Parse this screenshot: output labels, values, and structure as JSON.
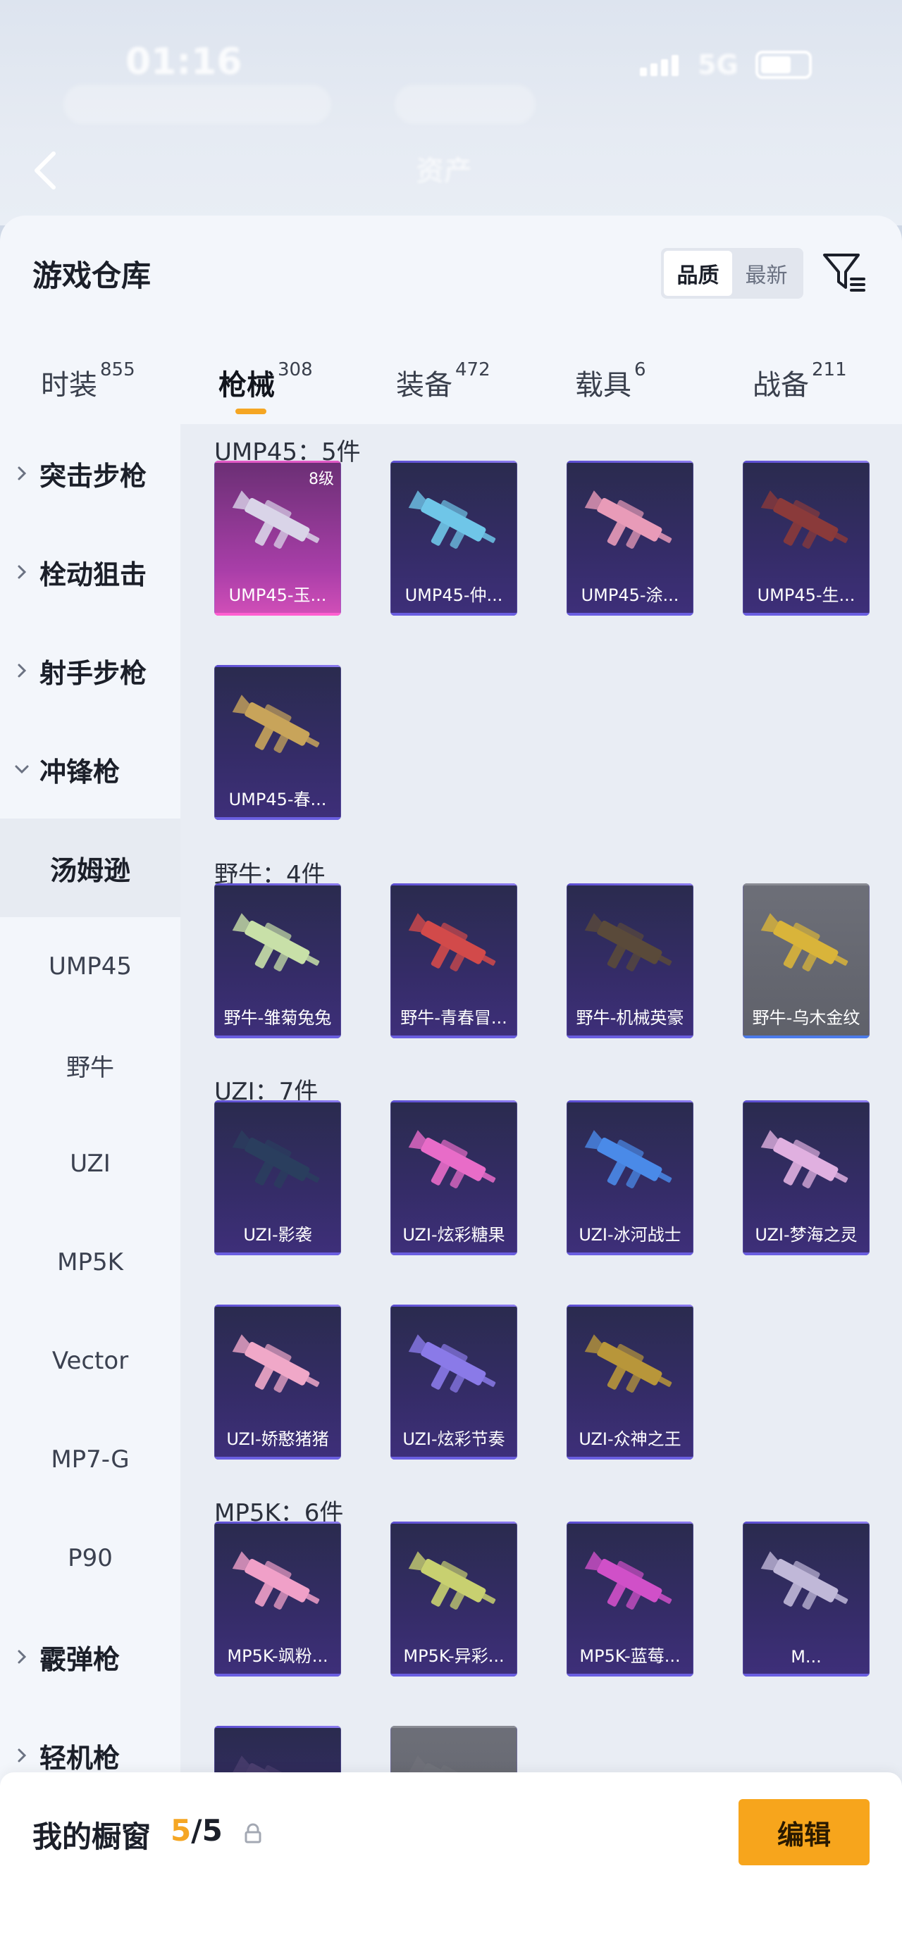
{
  "status_bar": {
    "time": "01:16",
    "network": "5G"
  },
  "header": {
    "title": "资产"
  },
  "warehouse": {
    "title": "游戏仓库",
    "sort_options": [
      "品质",
      "最新"
    ],
    "active_sort": "品质"
  },
  "tabs": [
    {
      "label": "时装",
      "count": "855"
    },
    {
      "label": "枪械",
      "count": "308"
    },
    {
      "label": "装备",
      "count": "472"
    },
    {
      "label": "载具",
      "count": "6"
    },
    {
      "label": "战备",
      "count": "211"
    }
  ],
  "active_tab": "枪械",
  "sidebar": {
    "groups": [
      {
        "label": "突击步枪",
        "expanded": false
      },
      {
        "label": "栓动狙击",
        "expanded": false
      },
      {
        "label": "射手步枪",
        "expanded": false
      },
      {
        "label": "冲锋枪",
        "expanded": true
      },
      {
        "label": "霰弹枪",
        "expanded": false
      },
      {
        "label": "轻机枪",
        "expanded": false
      }
    ],
    "subitems": [
      "汤姆逊",
      "UMP45",
      "野牛",
      "UZI",
      "MP5K",
      "Vector",
      "MP7-G",
      "P90"
    ],
    "selected": "汤姆逊"
  },
  "sections": [
    {
      "title": "UMP45：5件",
      "items": [
        {
          "label": "UMP45-玉...",
          "level": "8级",
          "style": "pink"
        },
        {
          "label": "UMP45-仲...",
          "style": "purple"
        },
        {
          "label": "UMP45-涂...",
          "style": "purple"
        },
        {
          "label": "UMP45-生...",
          "style": "purple"
        },
        {
          "label": "UMP45-春...",
          "style": "purple"
        }
      ]
    },
    {
      "title": "野牛：4件",
      "items": [
        {
          "label": "野牛-雏菊兔兔",
          "style": "purple"
        },
        {
          "label": "野牛-青春冒...",
          "style": "purple"
        },
        {
          "label": "野牛-机械英豪",
          "style": "purple"
        },
        {
          "label": "野牛-乌木金纹",
          "style": "gray"
        }
      ]
    },
    {
      "title": "UZI：7件",
      "items": [
        {
          "label": "UZI-影袭",
          "style": "purple"
        },
        {
          "label": "UZI-炫彩糖果",
          "style": "purple"
        },
        {
          "label": "UZI-冰河战士",
          "style": "purple"
        },
        {
          "label": "UZI-梦海之灵",
          "style": "purple"
        },
        {
          "label": "UZI-娇憨猪猪",
          "style": "purple"
        },
        {
          "label": "UZI-炫彩节奏",
          "style": "purple"
        },
        {
          "label": "UZI-众神之王",
          "style": "purple"
        }
      ]
    },
    {
      "title": "MP5K：6件",
      "items": [
        {
          "label": "MP5K-飒粉...",
          "style": "purple"
        },
        {
          "label": "MP5K-异彩...",
          "style": "purple"
        },
        {
          "label": "MP5K-蓝莓...",
          "style": "purple"
        },
        {
          "label": "M...",
          "style": "purple"
        },
        {
          "label": "",
          "style": "purple"
        },
        {
          "label": "",
          "style": "gray"
        }
      ]
    }
  ],
  "showcase": {
    "title": "我的橱窗",
    "current": "5",
    "total": "/5",
    "edit_label": "编辑"
  },
  "colors": {
    "accent": "#f7a51c",
    "card_purple": "#342c66",
    "card_pink": "#a83ea8",
    "card_gray": "#5f616a"
  }
}
